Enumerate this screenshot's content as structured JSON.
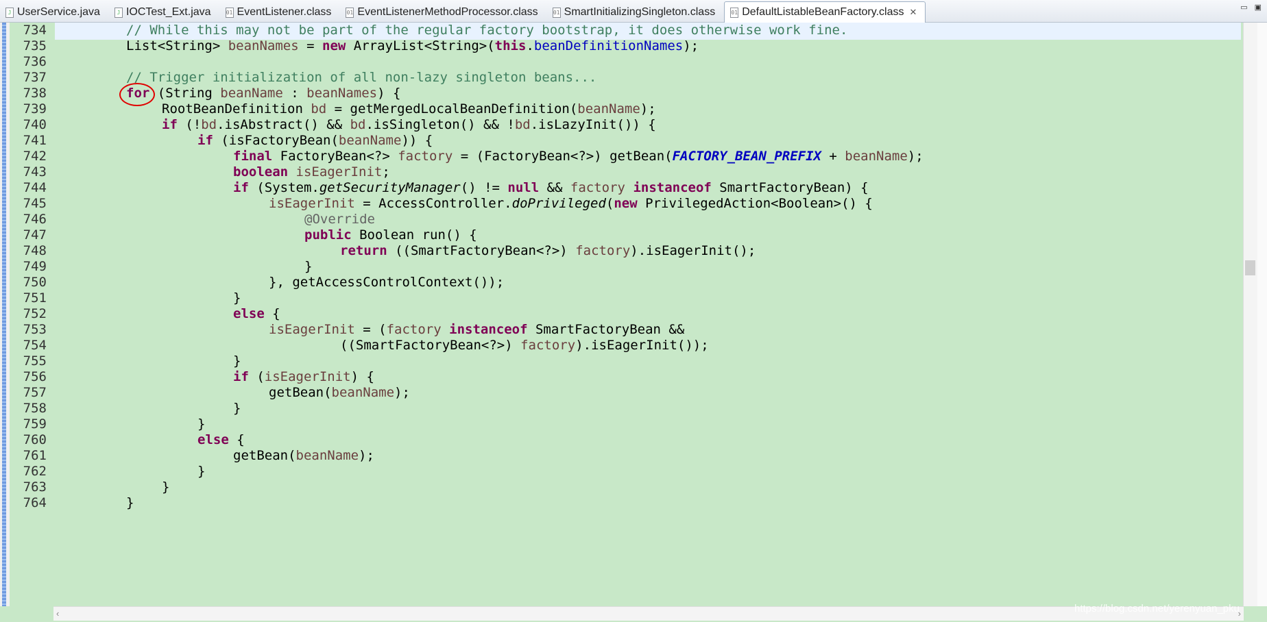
{
  "tabs": [
    {
      "label": "UserService.java",
      "icon": "java-file-icon"
    },
    {
      "label": "IOCTest_Ext.java",
      "icon": "java-file-icon"
    },
    {
      "label": "EventListener.class",
      "icon": "class-file-icon"
    },
    {
      "label": "EventListenerMethodProcessor.class",
      "icon": "class-file-icon"
    },
    {
      "label": "SmartInitializingSingleton.class",
      "icon": "class-file-icon"
    },
    {
      "label": "DefaultListableBeanFactory.class",
      "icon": "class-file-icon",
      "active": true
    }
  ],
  "line_numbers": [
    "734",
    "735",
    "736",
    "737",
    "738",
    "739",
    "740",
    "741",
    "742",
    "743",
    "744",
    "745",
    "746",
    "747",
    "748",
    "749",
    "750",
    "751",
    "752",
    "753",
    "754",
    "755",
    "756",
    "757",
    "758",
    "759",
    "760",
    "761",
    "762",
    "763",
    "764"
  ],
  "code": {
    "l734": "// While this may not be part of the regular factory bootstrap, it does otherwise work fine.",
    "l735": "List<String> beanNames = new ArrayList<String>(this.beanDefinitionNames);",
    "l737": "// Trigger initialization of all non-lazy singleton beans...",
    "l738": "for (String beanName : beanNames) {",
    "l739": "RootBeanDefinition bd = getMergedLocalBeanDefinition(beanName);",
    "l740": "if (!bd.isAbstract() && bd.isSingleton() && !bd.isLazyInit()) {",
    "l741": "if (isFactoryBean(beanName)) {",
    "l742": "final FactoryBean<?> factory = (FactoryBean<?>) getBean(FACTORY_BEAN_PREFIX + beanName);",
    "l743": "boolean isEagerInit;",
    "l744": "if (System.getSecurityManager() != null && factory instanceof SmartFactoryBean) {",
    "l745": "isEagerInit = AccessController.doPrivileged(new PrivilegedAction<Boolean>() {",
    "l746": "@Override",
    "l747": "public Boolean run() {",
    "l748": "return ((SmartFactoryBean<?>) factory).isEagerInit();",
    "l749": "}",
    "l750": "}, getAccessControlContext());",
    "l751": "}",
    "l752": "else {",
    "l753": "isEagerInit = (factory instanceof SmartFactoryBean &&",
    "l754": "((SmartFactoryBean<?>) factory).isEagerInit());",
    "l755": "}",
    "l756": "if (isEagerInit) {",
    "l757": "getBean(beanName);",
    "l758": "}",
    "l759": "}",
    "l760": "else {",
    "l761": "getBean(beanName);",
    "l762": "}",
    "l763": "}",
    "l764": "}"
  },
  "watermark": "https://blog.csdn.net/yerenyuan_pku",
  "colors": {
    "editor_bg": "#c8e8c8",
    "keyword": "#7f0055",
    "comment": "#3f7f5f",
    "field": "#0000c0",
    "annotation_circle": "#e00000",
    "current_line": "#e8f2fe"
  }
}
